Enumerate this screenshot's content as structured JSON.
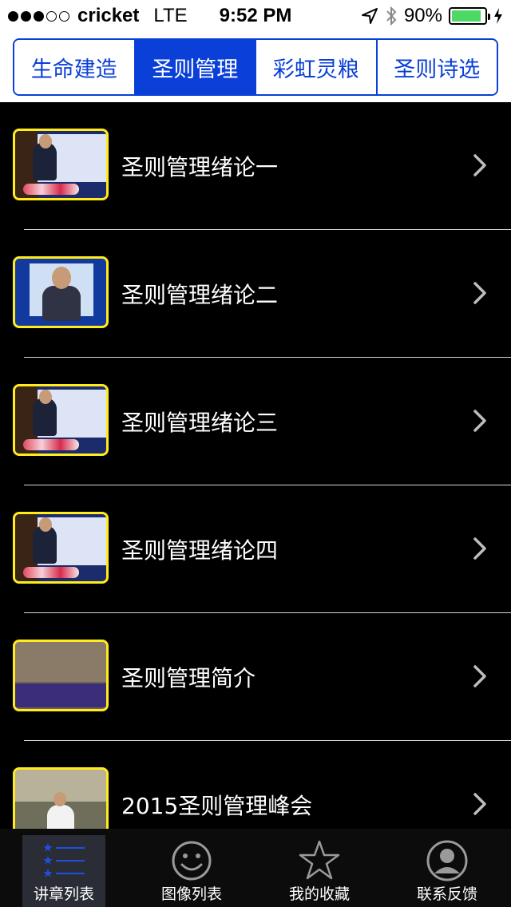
{
  "status_bar": {
    "carrier": "cricket",
    "network": "LTE",
    "time": "9:52 PM",
    "battery_percent": "90%",
    "battery_level": 0.9
  },
  "tabs": [
    {
      "label": "生命建造",
      "active": false
    },
    {
      "label": "圣则管理",
      "active": true
    },
    {
      "label": "彩虹灵粮",
      "active": false
    },
    {
      "label": "圣则诗选",
      "active": false
    }
  ],
  "rows": [
    {
      "title": "圣则管理绪论一"
    },
    {
      "title": "圣则管理绪论二"
    },
    {
      "title": "圣则管理绪论三"
    },
    {
      "title": "圣则管理绪论四"
    },
    {
      "title": "圣则管理简介"
    },
    {
      "title": "2015圣则管理峰会"
    }
  ],
  "tabbar": [
    {
      "label": "讲章列表",
      "icon": "list-icon",
      "active": true
    },
    {
      "label": "图像列表",
      "icon": "smiley-icon",
      "active": false
    },
    {
      "label": "我的收藏",
      "icon": "star-icon",
      "active": false
    },
    {
      "label": "联系反馈",
      "icon": "person-icon",
      "active": false
    }
  ],
  "colors": {
    "accent": "#0a3fd8",
    "thumb_border": "#ffec1a",
    "battery": "#4cd964"
  }
}
